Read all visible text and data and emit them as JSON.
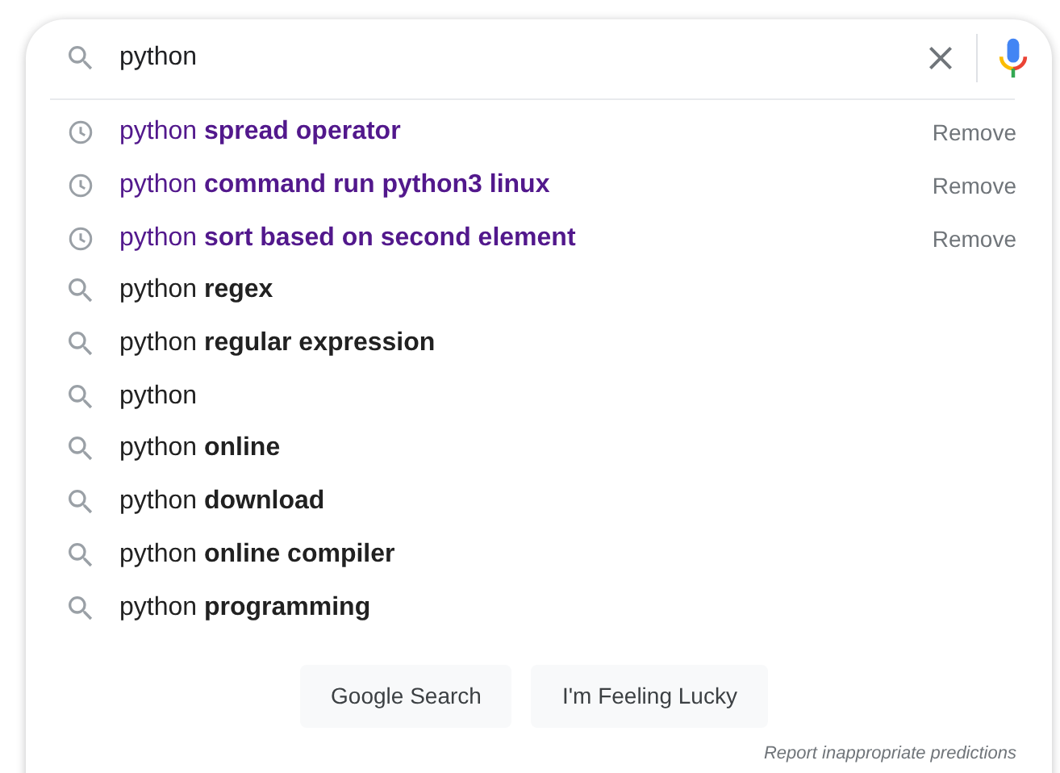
{
  "search": {
    "value": "python"
  },
  "suggestions": [
    {
      "kind": "history",
      "text": "python **spread operator**",
      "action": "Remove"
    },
    {
      "kind": "history",
      "text": "python **command run python3 linux**",
      "action": "Remove"
    },
    {
      "kind": "history",
      "text": "python **sort based on second element**",
      "action": "Remove"
    },
    {
      "kind": "query",
      "text": "python **regex**"
    },
    {
      "kind": "query",
      "text": "python **regular expression**"
    },
    {
      "kind": "query",
      "text": "python"
    },
    {
      "kind": "query",
      "text": "python **online**"
    },
    {
      "kind": "query",
      "text": "python **download**"
    },
    {
      "kind": "query",
      "text": "python **online compiler**"
    },
    {
      "kind": "query",
      "text": "python **programming**"
    }
  ],
  "buttons": [
    "Google Search",
    "I'm Feeling Lucky"
  ],
  "report_link": "Report inappropriate predictions"
}
